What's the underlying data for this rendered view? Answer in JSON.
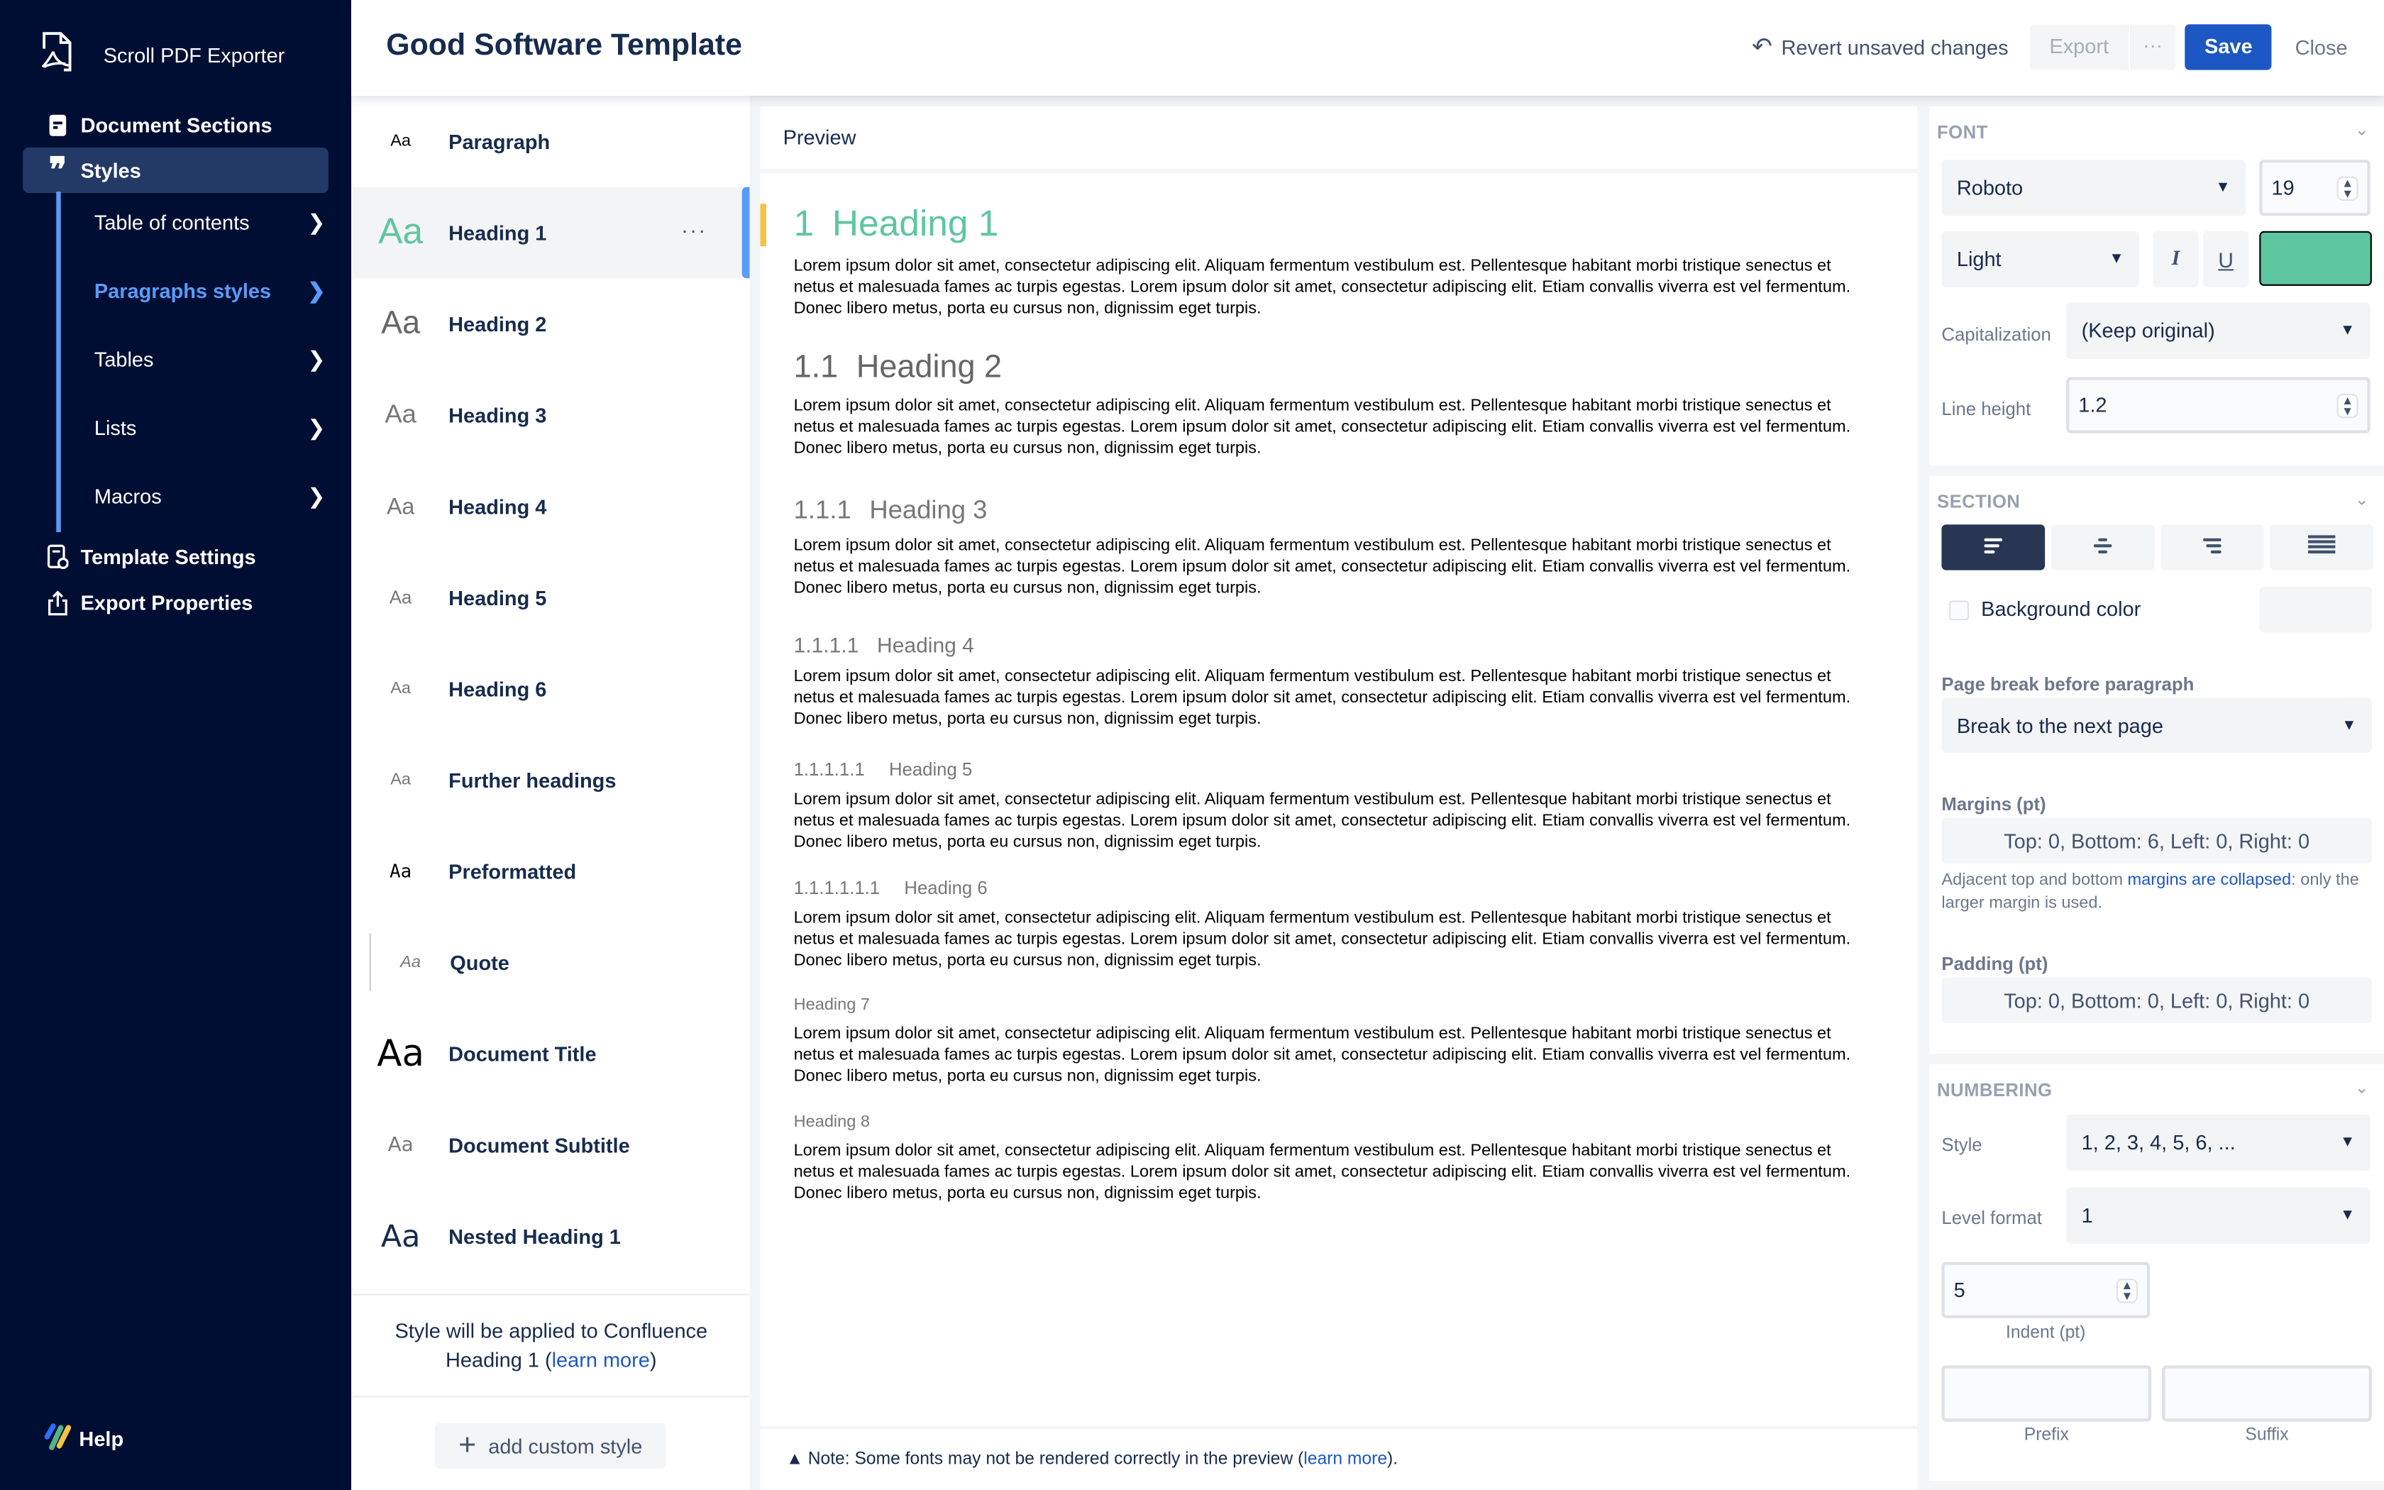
{
  "sidebar": {
    "brand": "Scroll PDF Exporter",
    "items": [
      {
        "label": "Document Sections",
        "icon": "document-icon"
      },
      {
        "label": "Styles",
        "icon": "quote-icon",
        "active": true
      },
      {
        "label": "Template Settings",
        "icon": "template-settings-icon"
      },
      {
        "label": "Export Properties",
        "icon": "export-icon"
      }
    ],
    "subitems": [
      {
        "label": "Table of contents"
      },
      {
        "label": "Paragraphs styles",
        "active": true
      },
      {
        "label": "Tables"
      },
      {
        "label": "Lists"
      },
      {
        "label": "Macros"
      }
    ],
    "help": "Help"
  },
  "header": {
    "title": "Good Software Template",
    "revert": "Revert unsaved changes",
    "export": "Export",
    "more": "···",
    "save": "Save",
    "close": "Close"
  },
  "styles": {
    "aa": "Aa",
    "items": [
      {
        "name": "Paragraph"
      },
      {
        "name": "Heading 1",
        "selected": true
      },
      {
        "name": "Heading 2"
      },
      {
        "name": "Heading 3"
      },
      {
        "name": "Heading 4"
      },
      {
        "name": "Heading 5"
      },
      {
        "name": "Heading 6"
      },
      {
        "name": "Further headings"
      },
      {
        "name": "Preformatted"
      },
      {
        "name": "Quote"
      },
      {
        "name": "Document Title"
      },
      {
        "name": "Document Subtitle"
      },
      {
        "name": "Nested Heading 1"
      }
    ],
    "row_more": "···",
    "applied_text_1": "Style will be applied to Confluence",
    "applied_text_2": "Heading 1 (",
    "applied_link": "learn more",
    "applied_text_3": ")",
    "add_custom": "add custom style"
  },
  "preview": {
    "title": "Preview",
    "paragraph_lines": [
      "Lorem ipsum dolor sit amet, consectetur adipiscing elit. Aliquam fermentum vestibulum est. Pellentesque habitant morbi tristique senectus et",
      "netus et malesuada fames ac turpis egestas. Lorem ipsum dolor sit amet, consectetur adipiscing elit. Etiam convallis viverra est vel fermentum.",
      "Donec libero metus, porta eu cursus non, dignissim eget turpis."
    ],
    "headings": [
      {
        "number": "1",
        "text": "Heading 1"
      },
      {
        "number": "1.1",
        "text": "Heading 2"
      },
      {
        "number": "1.1.1",
        "text": "Heading 3"
      },
      {
        "number": "1.1.1.1",
        "text": "Heading 4"
      },
      {
        "number": "1.1.1.1.1",
        "text": "Heading 5"
      },
      {
        "number": "1.1.1.1.1.1",
        "text": "Heading 6"
      },
      {
        "number": "",
        "text": "Heading 7"
      },
      {
        "number": "",
        "text": "Heading 8"
      }
    ],
    "note_prefix": "Note: Some fonts may not be rendered correctly in the preview (",
    "note_link": "learn more",
    "note_suffix": ")."
  },
  "font": {
    "section_title": "FONT",
    "family": "Roboto",
    "size": "19",
    "weight": "Light",
    "italic": "I",
    "underline": "U",
    "color": "#5ec6a0",
    "capitalization_label": "Capitalization",
    "capitalization": "(Keep original)",
    "line_height_label": "Line height",
    "line_height": "1.2"
  },
  "section": {
    "section_title": "SECTION",
    "alignment": "left",
    "background_color_label": "Background color",
    "background_color_checked": false,
    "page_break_label": "Page break before paragraph",
    "page_break": "Break to the next page",
    "margins_label": "Margins (pt)",
    "margins": "Top: 0, Bottom: 6, Left: 0, Right: 0",
    "margins_note_1": "Adjacent top and bottom ",
    "margins_note_link": "margins are collapsed",
    "margins_note_2": ": only the larger margin is used.",
    "padding_label": "Padding (pt)",
    "padding": "Top: 0, Bottom: 0, Left: 0, Right: 0"
  },
  "numbering": {
    "section_title": "NUMBERING",
    "style_label": "Style",
    "style": "1, 2, 3, 4, 5, 6, ...",
    "level_format_label": "Level format",
    "level_format": "1",
    "indent": "5",
    "indent_label": "Indent (pt)",
    "prefix": "",
    "prefix_label": "Prefix",
    "suffix": "",
    "suffix_label": "Suffix"
  },
  "colors": {
    "sidebar_bg": "#010e33",
    "accent": "#5b9bf7",
    "primary": "#1d57c4",
    "heading1": "#5ec6a0",
    "marker": "#f6c244"
  }
}
